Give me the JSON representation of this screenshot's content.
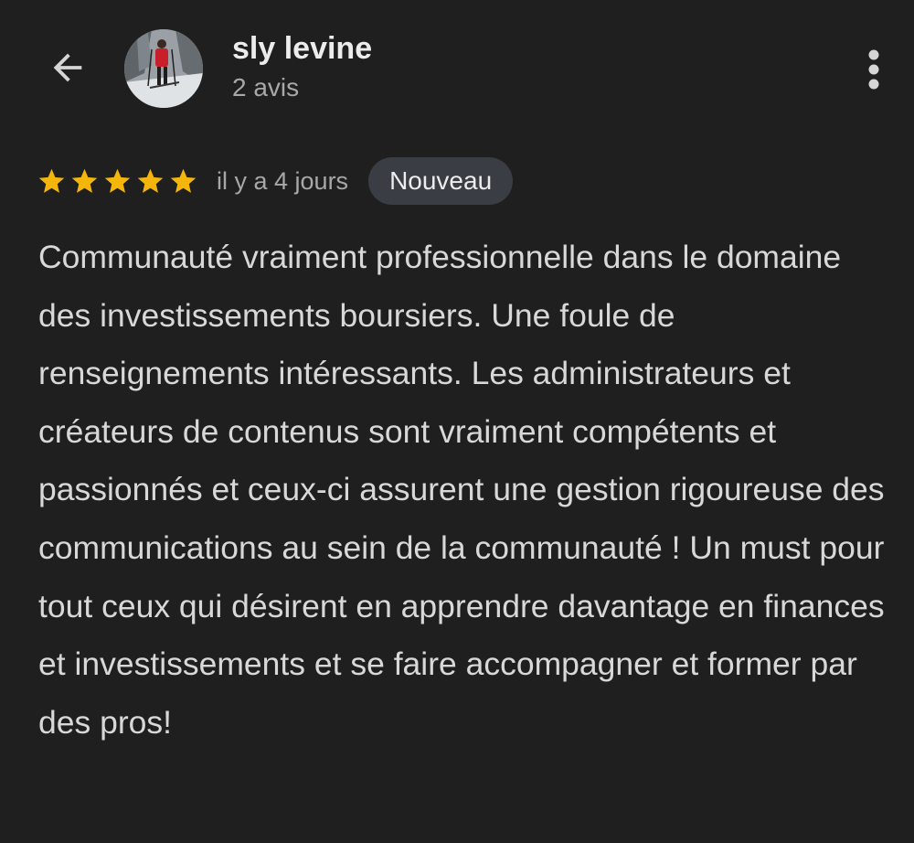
{
  "header": {
    "back_icon": "arrow-back-icon",
    "more_icon": "more-vert-icon",
    "reviewer": {
      "name": "sly levine",
      "review_count": "2 avis",
      "avatar": "reviewer-avatar"
    }
  },
  "review": {
    "rating": 5,
    "max_rating": 5,
    "star_color": "#f5b60c",
    "date": "il y a 4 jours",
    "badge": "Nouveau",
    "text": "Communauté vraiment professionnelle dans le domaine des investissements boursiers. Une foule de renseignements intéressants. Les administrateurs et créateurs de contenus sont vraiment compétents et passionnés et ceux-ci assurent une gestion rigoureuse des communications au sein de la communauté ! Un must pour tout ceux qui désirent en apprendre davantage en finances et investissements et se faire accompagner et former par des pros!"
  }
}
